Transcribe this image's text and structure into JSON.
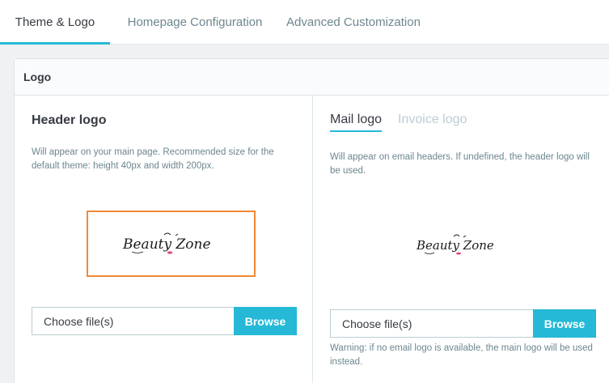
{
  "tabs": [
    {
      "label": "Theme & Logo"
    },
    {
      "label": "Homepage Configuration"
    },
    {
      "label": "Advanced Customization"
    }
  ],
  "card": {
    "header": "Logo"
  },
  "header_logo": {
    "title": "Header logo",
    "help": "Will appear on your main page. Recommended size for the default theme: height 40px and width 200px.",
    "file_placeholder": "Choose file(s)",
    "browse_label": "Browse",
    "logo_text": "Beauty Zone"
  },
  "right_panel": {
    "subtabs": [
      {
        "label": "Mail logo"
      },
      {
        "label": "Invoice logo"
      }
    ],
    "help": "Will appear on email headers. If undefined, the header logo will be used.",
    "file_placeholder": "Choose file(s)",
    "browse_label": "Browse",
    "warning": "Warning: if no email logo is available, the main logo will be used instead.",
    "logo_text": "Beauty Zone"
  },
  "colors": {
    "accent": "#25b9d7",
    "highlight_border": "#f18a35",
    "logo_pink": "#e0477a"
  }
}
